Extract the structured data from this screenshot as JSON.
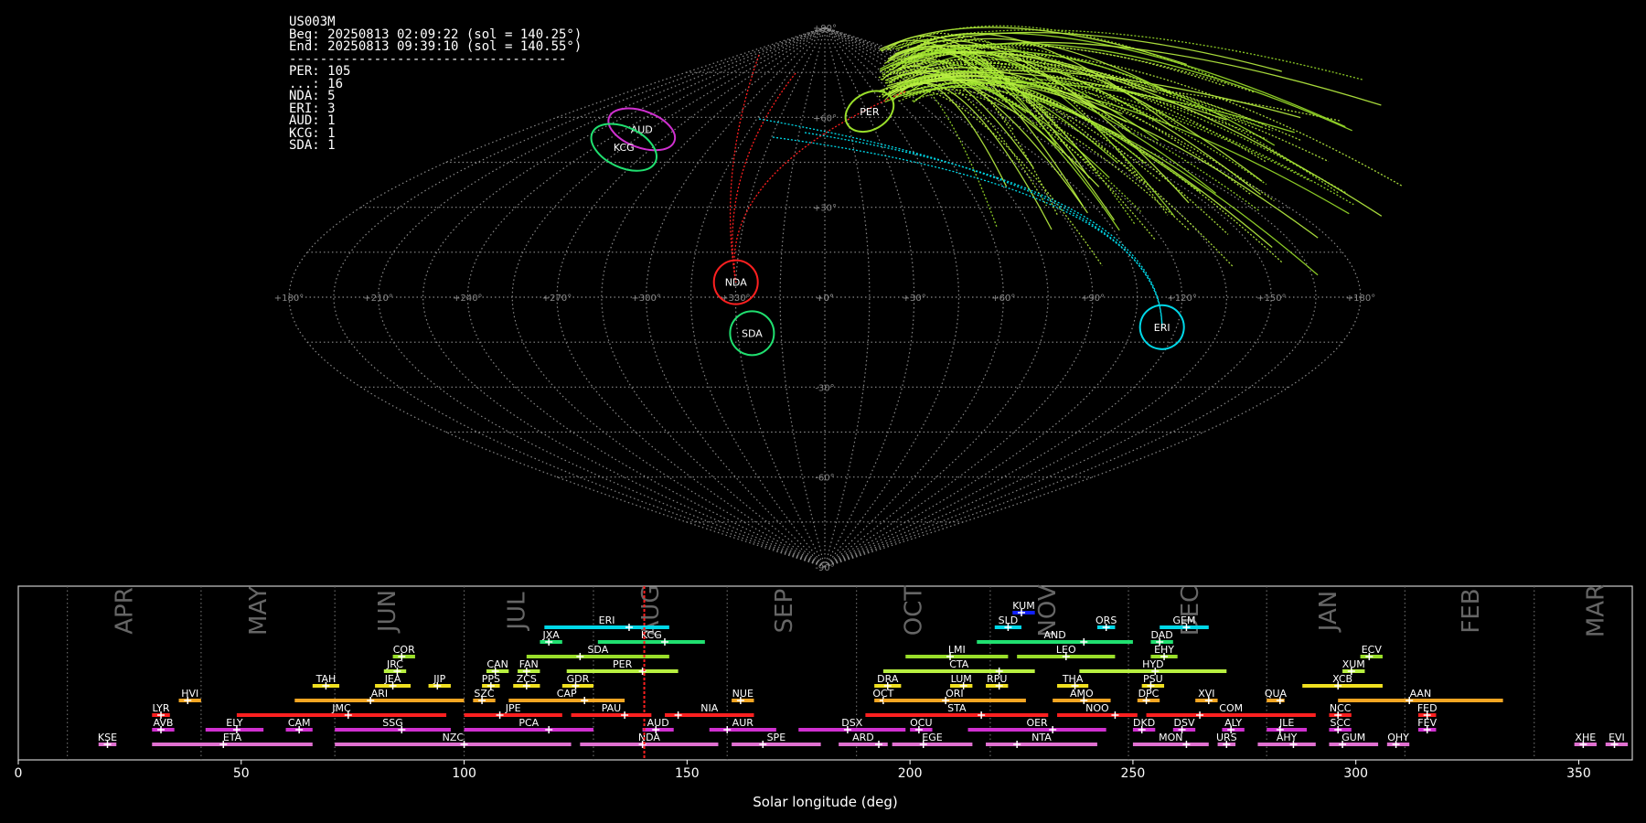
{
  "info": {
    "station": "US003M",
    "beg": "Beg: 20250813 02:09:22 (sol = 140.25°)",
    "end": "End: 20250813 09:39:10 (sol = 140.55°)",
    "separator": "------------------------------------",
    "counts": [
      "PER: 105",
      "...: 16",
      "NDA: 5",
      "ERI: 3",
      "AUD: 1",
      "KCG: 1",
      "SDA: 1"
    ]
  },
  "colors": {
    "cyan": "#00d8e8",
    "green": "#20e070",
    "lime": "#9adf2a",
    "ygreen": "#b8f040",
    "yellow": "#f0e020",
    "orange": "#f5a623",
    "red": "#ff2020",
    "magenta": "#d030d0",
    "pink": "#e070d0",
    "blue": "#1020ff"
  },
  "chart_data": [
    {
      "type": "scatter",
      "projection": "sinusoidal",
      "grid": true,
      "lon_tick_labels": [
        "+180°",
        "+150°",
        "+120°",
        "+90°",
        "+60°",
        "+30°",
        "+0°",
        "+330°",
        "+300°",
        "+270°",
        "+240°",
        "+210°",
        "+180°"
      ],
      "lat_tick_labels": [
        "+90°",
        "+60°",
        "+30°",
        "+0°",
        "-30°",
        "-60°",
        "-90°"
      ],
      "radiant_areas": [
        {
          "name": "PER",
          "x": 32,
          "y": 62,
          "color": "lime"
        },
        {
          "name": "AUD",
          "x": -110,
          "y": 56,
          "color": "magenta"
        },
        {
          "name": "KCG",
          "x": -105,
          "y": 50,
          "color": "green"
        },
        {
          "name": "NDA",
          "x": -30,
          "y": 5,
          "color": "red"
        },
        {
          "name": "ERI",
          "x": 115,
          "y": -10,
          "color": "cyan"
        },
        {
          "name": "SDA",
          "x": -25,
          "y": -12,
          "color": "green"
        }
      ]
    },
    {
      "type": "bar",
      "xlabel": "Solar longitude (deg)",
      "xlim": [
        0,
        362
      ],
      "x_ticks": [
        0,
        50,
        100,
        150,
        200,
        250,
        300,
        350
      ],
      "current_sol": 140.4,
      "month_labels": [
        {
          "label": "APR",
          "x": 24
        },
        {
          "label": "MAY",
          "x": 54
        },
        {
          "label": "JUN",
          "x": 83
        },
        {
          "label": "JUL",
          "x": 112
        },
        {
          "label": "AUG",
          "x": 142
        },
        {
          "label": "SEP",
          "x": 172
        },
        {
          "label": "OCT",
          "x": 201
        },
        {
          "label": "NOV",
          "x": 231
        },
        {
          "label": "DEC",
          "x": 263
        },
        {
          "label": "JAN",
          "x": 294
        },
        {
          "label": "FEB",
          "x": 326
        },
        {
          "label": "MAR",
          "x": 354
        }
      ],
      "month_bounds": [
        11,
        41,
        71,
        100,
        129,
        159,
        188,
        218,
        249,
        280,
        311,
        340
      ],
      "showers": [
        {
          "name": "KUM",
          "start": 223,
          "end": 228,
          "peak": 225,
          "row": 10,
          "color": "blue"
        },
        {
          "name": "ERI",
          "start": 118,
          "end": 146,
          "peak": 137,
          "row": 9,
          "color": "cyan"
        },
        {
          "name": "SLD",
          "start": 219,
          "end": 225,
          "peak": 222,
          "row": 9,
          "color": "cyan"
        },
        {
          "name": "ORS",
          "start": 242,
          "end": 246,
          "peak": 244,
          "row": 9,
          "color": "cyan"
        },
        {
          "name": "GEM",
          "start": 256,
          "end": 267,
          "peak": 262,
          "row": 9,
          "color": "cyan"
        },
        {
          "name": "JXA",
          "start": 117,
          "end": 122,
          "peak": 119,
          "row": 8,
          "color": "green"
        },
        {
          "name": "KCG",
          "start": 130,
          "end": 154,
          "peak": 145,
          "row": 8,
          "color": "green"
        },
        {
          "name": "AND",
          "start": 215,
          "end": 250,
          "peak": 239,
          "row": 8,
          "color": "green"
        },
        {
          "name": "DAD",
          "start": 254,
          "end": 259,
          "peak": 256,
          "row": 8,
          "color": "green"
        },
        {
          "name": "COR",
          "start": 84,
          "end": 89,
          "peak": 86,
          "row": 7,
          "color": "lime"
        },
        {
          "name": "SDA",
          "start": 114,
          "end": 146,
          "peak": 126,
          "row": 7,
          "color": "lime"
        },
        {
          "name": "LMI",
          "start": 199,
          "end": 222,
          "peak": 209,
          "row": 7,
          "color": "lime"
        },
        {
          "name": "LEO",
          "start": 224,
          "end": 246,
          "peak": 235,
          "row": 7,
          "color": "lime"
        },
        {
          "name": "EHY",
          "start": 254,
          "end": 260,
          "peak": 257,
          "row": 7,
          "color": "lime"
        },
        {
          "name": "ECV",
          "start": 301,
          "end": 306,
          "peak": 303,
          "row": 7,
          "color": "lime"
        },
        {
          "name": "JRC",
          "start": 82,
          "end": 87,
          "peak": 85,
          "row": 6,
          "color": "ygreen"
        },
        {
          "name": "CAN",
          "start": 105,
          "end": 110,
          "peak": 107,
          "row": 6,
          "color": "ygreen"
        },
        {
          "name": "FAN",
          "start": 112,
          "end": 117,
          "peak": 114,
          "row": 6,
          "color": "ygreen"
        },
        {
          "name": "PER",
          "start": 123,
          "end": 148,
          "peak": 140,
          "row": 6,
          "color": "ygreen"
        },
        {
          "name": "CTA",
          "start": 194,
          "end": 228,
          "peak": 220,
          "row": 6,
          "color": "ygreen"
        },
        {
          "name": "HYD",
          "start": 238,
          "end": 271,
          "peak": 255,
          "row": 6,
          "color": "ygreen"
        },
        {
          "name": "XUM",
          "start": 297,
          "end": 302,
          "peak": 299,
          "row": 6,
          "color": "ygreen"
        },
        {
          "name": "TAH",
          "start": 66,
          "end": 72,
          "peak": 69,
          "row": 5,
          "color": "yellow"
        },
        {
          "name": "JEA",
          "start": 80,
          "end": 88,
          "peak": 84,
          "row": 5,
          "color": "yellow"
        },
        {
          "name": "JIP",
          "start": 92,
          "end": 97,
          "peak": 94,
          "row": 5,
          "color": "yellow"
        },
        {
          "name": "PPS",
          "start": 104,
          "end": 108,
          "peak": 106,
          "row": 5,
          "color": "yellow"
        },
        {
          "name": "ZCS",
          "start": 111,
          "end": 117,
          "peak": 114,
          "row": 5,
          "color": "yellow"
        },
        {
          "name": "GDR",
          "start": 122,
          "end": 129,
          "peak": 125,
          "row": 5,
          "color": "yellow"
        },
        {
          "name": "DRA",
          "start": 192,
          "end": 198,
          "peak": 195,
          "row": 5,
          "color": "yellow"
        },
        {
          "name": "LUM",
          "start": 209,
          "end": 214,
          "peak": 212,
          "row": 5,
          "color": "yellow"
        },
        {
          "name": "RPU",
          "start": 217,
          "end": 222,
          "peak": 220,
          "row": 5,
          "color": "yellow"
        },
        {
          "name": "THA",
          "start": 233,
          "end": 240,
          "peak": 237,
          "row": 5,
          "color": "yellow"
        },
        {
          "name": "PSU",
          "start": 252,
          "end": 257,
          "peak": 254,
          "row": 5,
          "color": "yellow"
        },
        {
          "name": "XCB",
          "start": 288,
          "end": 306,
          "peak": 296,
          "row": 5,
          "color": "yellow"
        },
        {
          "name": "HVI",
          "start": 36,
          "end": 41,
          "peak": 38,
          "row": 4,
          "color": "orange"
        },
        {
          "name": "ARI",
          "start": 62,
          "end": 100,
          "peak": 79,
          "row": 4,
          "color": "orange"
        },
        {
          "name": "SZC",
          "start": 102,
          "end": 107,
          "peak": 104,
          "row": 4,
          "color": "orange"
        },
        {
          "name": "CAP",
          "start": 110,
          "end": 136,
          "peak": 127,
          "row": 4,
          "color": "orange"
        },
        {
          "name": "NUE",
          "start": 160,
          "end": 165,
          "peak": 162,
          "row": 4,
          "color": "orange"
        },
        {
          "name": "OCT",
          "start": 192,
          "end": 196,
          "peak": 194,
          "row": 4,
          "color": "orange"
        },
        {
          "name": "ORI",
          "start": 194,
          "end": 226,
          "peak": 208,
          "row": 4,
          "color": "orange"
        },
        {
          "name": "AMO",
          "start": 232,
          "end": 245,
          "peak": 239,
          "row": 4,
          "color": "orange"
        },
        {
          "name": "DPC",
          "start": 251,
          "end": 256,
          "peak": 253,
          "row": 4,
          "color": "orange"
        },
        {
          "name": "XVI",
          "start": 264,
          "end": 269,
          "peak": 267,
          "row": 4,
          "color": "orange"
        },
        {
          "name": "QUA",
          "start": 280,
          "end": 284,
          "peak": 283,
          "row": 4,
          "color": "orange"
        },
        {
          "name": "AAN",
          "start": 296,
          "end": 333,
          "peak": 312,
          "row": 4,
          "color": "orange"
        },
        {
          "name": "LYR",
          "start": 30,
          "end": 34,
          "peak": 32,
          "row": 3,
          "color": "red"
        },
        {
          "name": "JMC",
          "start": 49,
          "end": 96,
          "peak": 74,
          "row": 3,
          "color": "red"
        },
        {
          "name": "JPE",
          "start": 100,
          "end": 122,
          "peak": 108,
          "row": 3,
          "color": "red"
        },
        {
          "name": "PAU",
          "start": 124,
          "end": 142,
          "peak": 136,
          "row": 3,
          "color": "red"
        },
        {
          "name": "NIA",
          "start": 145,
          "end": 165,
          "peak": 148,
          "row": 3,
          "color": "red"
        },
        {
          "name": "STA",
          "start": 190,
          "end": 231,
          "peak": 216,
          "row": 3,
          "color": "red"
        },
        {
          "name": "NOO",
          "start": 233,
          "end": 251,
          "peak": 246,
          "row": 3,
          "color": "red"
        },
        {
          "name": "COM",
          "start": 253,
          "end": 291,
          "peak": 265,
          "row": 3,
          "color": "red"
        },
        {
          "name": "NCC",
          "start": 294,
          "end": 299,
          "peak": 296,
          "row": 3,
          "color": "red"
        },
        {
          "name": "FED",
          "start": 314,
          "end": 318,
          "peak": 316,
          "row": 3,
          "color": "red"
        },
        {
          "name": "AVB",
          "start": 30,
          "end": 35,
          "peak": 32,
          "row": 2,
          "color": "magenta"
        },
        {
          "name": "ELY",
          "start": 42,
          "end": 55,
          "peak": 49,
          "row": 2,
          "color": "magenta"
        },
        {
          "name": "CAM",
          "start": 60,
          "end": 66,
          "peak": 63,
          "row": 2,
          "color": "magenta"
        },
        {
          "name": "SSG",
          "start": 71,
          "end": 97,
          "peak": 86,
          "row": 2,
          "color": "magenta"
        },
        {
          "name": "PCA",
          "start": 100,
          "end": 129,
          "peak": 119,
          "row": 2,
          "color": "magenta"
        },
        {
          "name": "AUD",
          "start": 140,
          "end": 147,
          "peak": 143,
          "row": 2,
          "color": "magenta"
        },
        {
          "name": "AUR",
          "start": 155,
          "end": 170,
          "peak": 159,
          "row": 2,
          "color": "magenta"
        },
        {
          "name": "DSX",
          "start": 175,
          "end": 199,
          "peak": 186,
          "row": 2,
          "color": "magenta"
        },
        {
          "name": "OCU",
          "start": 200,
          "end": 205,
          "peak": 202,
          "row": 2,
          "color": "magenta"
        },
        {
          "name": "OER",
          "start": 213,
          "end": 244,
          "peak": 232,
          "row": 2,
          "color": "magenta"
        },
        {
          "name": "DKD",
          "start": 250,
          "end": 255,
          "peak": 252,
          "row": 2,
          "color": "magenta"
        },
        {
          "name": "DSV",
          "start": 259,
          "end": 264,
          "peak": 261,
          "row": 2,
          "color": "magenta"
        },
        {
          "name": "ALY",
          "start": 270,
          "end": 275,
          "peak": 272,
          "row": 2,
          "color": "magenta"
        },
        {
          "name": "JLE",
          "start": 280,
          "end": 289,
          "peak": 283,
          "row": 2,
          "color": "magenta"
        },
        {
          "name": "SCC",
          "start": 294,
          "end": 299,
          "peak": 296,
          "row": 2,
          "color": "magenta"
        },
        {
          "name": "FEV",
          "start": 314,
          "end": 318,
          "peak": 316,
          "row": 2,
          "color": "magenta"
        },
        {
          "name": "KSE",
          "start": 18,
          "end": 22,
          "peak": 20,
          "row": 1,
          "color": "pink"
        },
        {
          "name": "ETA",
          "start": 30,
          "end": 66,
          "peak": 46,
          "row": 1,
          "color": "pink"
        },
        {
          "name": "NZC",
          "start": 71,
          "end": 124,
          "peak": 100,
          "row": 1,
          "color": "pink"
        },
        {
          "name": "NDA",
          "start": 126,
          "end": 157,
          "peak": 140,
          "row": 1,
          "color": "pink"
        },
        {
          "name": "SPE",
          "start": 160,
          "end": 180,
          "peak": 167,
          "row": 1,
          "color": "pink"
        },
        {
          "name": "ARD",
          "start": 184,
          "end": 195,
          "peak": 193,
          "row": 1,
          "color": "pink"
        },
        {
          "name": "EGE",
          "start": 196,
          "end": 214,
          "peak": 203,
          "row": 1,
          "color": "pink"
        },
        {
          "name": "NTA",
          "start": 217,
          "end": 242,
          "peak": 224,
          "row": 1,
          "color": "pink"
        },
        {
          "name": "MON",
          "start": 250,
          "end": 267,
          "peak": 262,
          "row": 1,
          "color": "pink"
        },
        {
          "name": "URS",
          "start": 269,
          "end": 273,
          "peak": 271,
          "row": 1,
          "color": "pink"
        },
        {
          "name": "AHY",
          "start": 278,
          "end": 291,
          "peak": 286,
          "row": 1,
          "color": "pink"
        },
        {
          "name": "GUM",
          "start": 294,
          "end": 305,
          "peak": 297,
          "row": 1,
          "color": "pink"
        },
        {
          "name": "OHY",
          "start": 307,
          "end": 312,
          "peak": 309,
          "row": 1,
          "color": "pink"
        },
        {
          "name": "XHE",
          "start": 349,
          "end": 354,
          "peak": 351,
          "row": 1,
          "color": "pink"
        },
        {
          "name": "EVI",
          "start": 356,
          "end": 361,
          "peak": 358,
          "row": 1,
          "color": "pink"
        }
      ]
    }
  ]
}
